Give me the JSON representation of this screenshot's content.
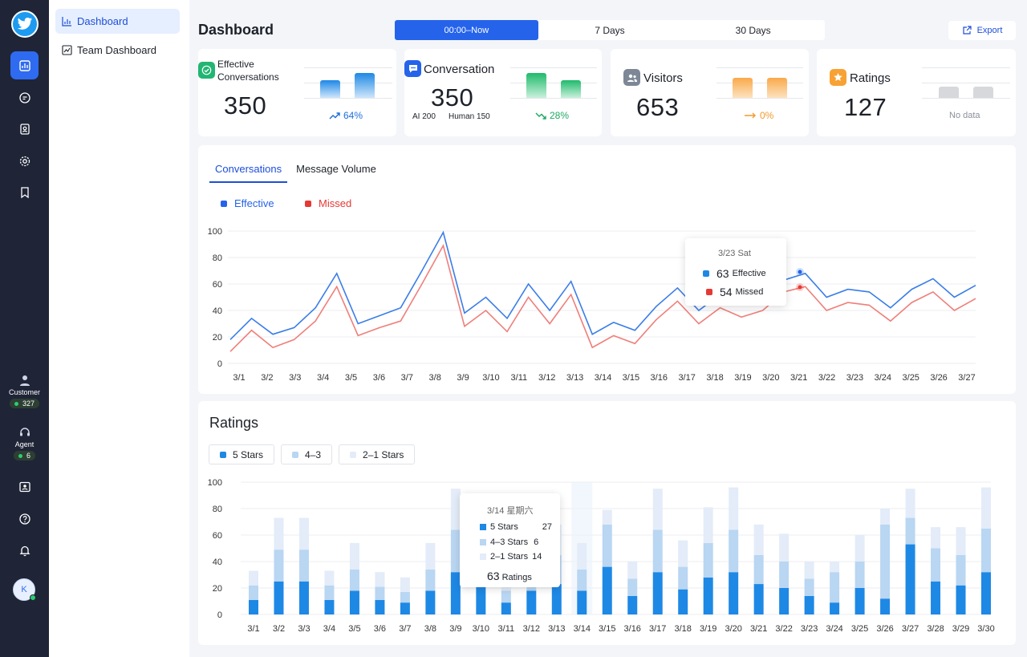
{
  "nav": {
    "items": [
      {
        "label": "Dashboard",
        "icon": "bar-chart-icon"
      },
      {
        "label": "Team Dashboard",
        "icon": "trend-chart-icon"
      }
    ]
  },
  "rail": {
    "customer_label": "Customer",
    "customer_count": "327",
    "agent_label": "Agent",
    "agent_count": "6",
    "avatar_initial": "K"
  },
  "header": {
    "title": "Dashboard",
    "ranges": [
      "00:00–Now",
      "7 Days",
      "30 Days"
    ],
    "export_label": "Export"
  },
  "kpis": {
    "effective": {
      "label_line1": "Effective",
      "label_line2": "Conversations",
      "value": "350",
      "trend": "64%",
      "trend_dir": "up",
      "bars": [
        0.4,
        0.55
      ]
    },
    "conversation": {
      "label": "Conversation",
      "value": "350",
      "ai": "AI 200",
      "human": "Human 150",
      "trend": "28%",
      "trend_dir": "down",
      "bars": [
        0.55,
        0.4
      ]
    },
    "visitors": {
      "label": "Visitors",
      "value": "653",
      "trend": "0%",
      "trend_dir": "flat",
      "bars": [
        0.45,
        0.45
      ]
    },
    "ratings": {
      "label": "Ratings",
      "value": "127",
      "trend": "No data",
      "bars": [
        0.25,
        0.25
      ]
    }
  },
  "conv_panel": {
    "tabs": [
      "Conversations",
      "Message Volume"
    ],
    "legend": [
      {
        "label": "Effective",
        "color": "#2563eb"
      },
      {
        "label": "Missed",
        "color": "#e53935"
      }
    ],
    "tooltip": {
      "date": "3/23 Sat",
      "effective_value": "63",
      "effective_label": "Effective",
      "missed_value": "54",
      "missed_label": "Missed"
    }
  },
  "ratings_panel": {
    "title": "Ratings",
    "chips": [
      {
        "label": "5 Stars",
        "color": "#1e88e5"
      },
      {
        "label": "4–3",
        "color": "#b9d6f2"
      },
      {
        "label": "2–1 Stars",
        "color": "#e3ecf8"
      }
    ],
    "tooltip": {
      "date": "3/14 星期六",
      "five_label": "5 Stars",
      "five_value": "27",
      "four_label": "4–3 Stars",
      "four_value": "6",
      "two_label": "2–1 Stars",
      "two_value": "14",
      "total_value": "63",
      "total_label": "Ratings"
    }
  },
  "chart_data": [
    {
      "type": "line",
      "categories": [
        "3/1",
        "3/2",
        "3/3",
        "3/4",
        "3/5",
        "3/6",
        "3/7",
        "3/8",
        "3/9",
        "3/10",
        "3/11",
        "3/12",
        "3/13",
        "3/14",
        "3/15",
        "3/16",
        "3/17",
        "3/18",
        "3/19",
        "3/20",
        "3/21",
        "3/22",
        "3/23",
        "3/24",
        "3/25",
        "3/26",
        "3/27"
      ],
      "ylim": [
        0,
        100
      ],
      "yticks": [
        0,
        20,
        40,
        60,
        80,
        100
      ],
      "series": [
        {
          "name": "Effective",
          "color": "#2563eb",
          "values": [
            18,
            34,
            22,
            27,
            42,
            68,
            30,
            36,
            42,
            70,
            99,
            38,
            50,
            34,
            60,
            40,
            62,
            22,
            31,
            25,
            43,
            57,
            40,
            52,
            45,
            50,
            63,
            68,
            50,
            56,
            54,
            42,
            56,
            64,
            50,
            59
          ]
        },
        {
          "name": "Missed",
          "color": "#e53935",
          "values": [
            9,
            25,
            12,
            18,
            32,
            58,
            21,
            27,
            32,
            60,
            89,
            28,
            40,
            24,
            50,
            30,
            52,
            12,
            21,
            15,
            33,
            47,
            30,
            42,
            35,
            40,
            54,
            58,
            40,
            46,
            44,
            32,
            46,
            54,
            40,
            49
          ]
        }
      ]
    },
    {
      "type": "bar",
      "stacked": true,
      "categories": [
        "3/1",
        "3/2",
        "3/3",
        "3/4",
        "3/5",
        "3/6",
        "3/7",
        "3/8",
        "3/9",
        "3/10",
        "3/11",
        "3/12",
        "3/13",
        "3/14",
        "3/15",
        "3/16",
        "3/17",
        "3/18",
        "3/19",
        "3/20",
        "3/21",
        "3/22",
        "3/23",
        "3/24",
        "3/25",
        "3/26",
        "3/27",
        "3/28",
        "3/29",
        "3/30"
      ],
      "ylim": [
        0,
        100
      ],
      "yticks": [
        0,
        20,
        40,
        60,
        80,
        100
      ],
      "series": [
        {
          "name": "5 Stars",
          "color": "#1e88e5",
          "values": [
            11,
            25,
            25,
            11,
            18,
            11,
            9,
            18,
            32,
            23,
            9,
            18,
            23,
            18,
            36,
            14,
            32,
            19,
            28,
            32,
            23,
            20,
            14,
            9,
            20,
            12,
            53,
            25,
            22,
            32
          ]
        },
        {
          "name": "4–3",
          "color": "#b9d6f2",
          "values": [
            11,
            24,
            24,
            11,
            16,
            10,
            8,
            16,
            32,
            22,
            9,
            16,
            22,
            16,
            32,
            13,
            32,
            17,
            26,
            32,
            22,
            20,
            13,
            23,
            20,
            56,
            20,
            25,
            23,
            33
          ]
        },
        {
          "name": "2–1 Stars",
          "color": "#e3ecf8",
          "values": [
            11,
            24,
            24,
            11,
            20,
            11,
            11,
            20,
            31,
            22,
            9,
            20,
            23,
            20,
            11,
            13,
            31,
            20,
            27,
            32,
            23,
            21,
            13,
            8,
            20,
            12,
            22,
            16,
            21,
            31
          ]
        }
      ]
    }
  ]
}
